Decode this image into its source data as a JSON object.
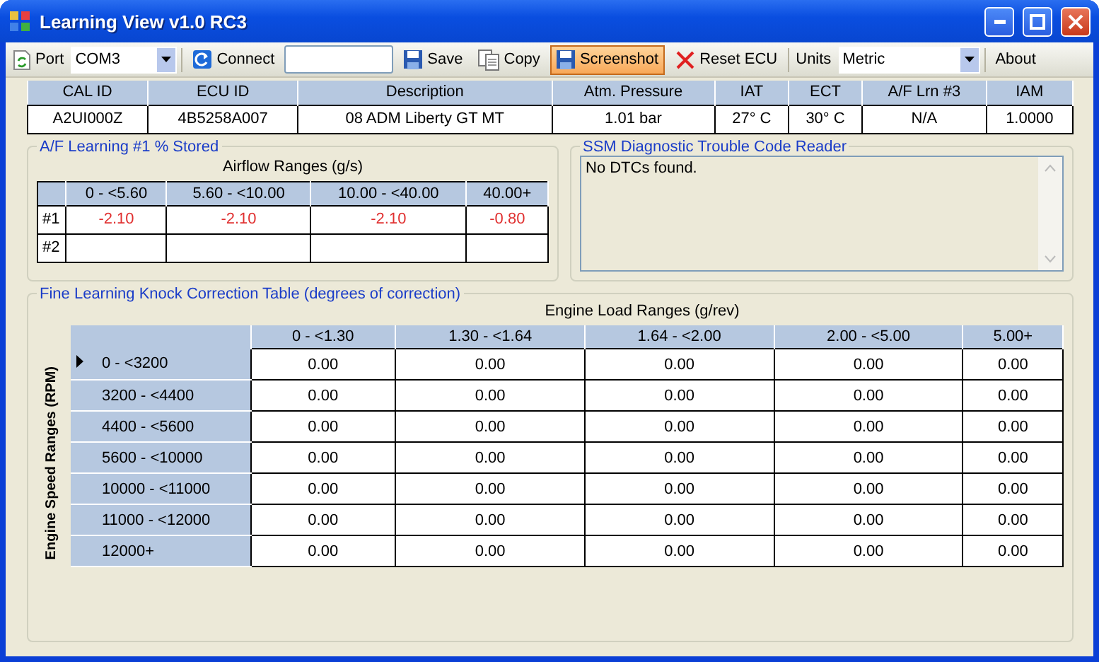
{
  "window": {
    "title": "Learning View v1.0 RC3"
  },
  "toolbar": [
    {
      "kind": "label",
      "text": "Port"
    },
    {
      "kind": "combo",
      "value": "COM3"
    },
    {
      "kind": "separator"
    },
    {
      "kind": "button",
      "text": "Connect",
      "highlighted": false
    },
    {
      "kind": "textbox"
    },
    {
      "kind": "button",
      "text": "Save",
      "highlighted": false
    },
    {
      "kind": "button",
      "text": "Copy",
      "highlighted": false
    },
    {
      "kind": "button",
      "text": "Screenshot",
      "highlighted": true
    },
    {
      "kind": "button",
      "text": "Reset ECU",
      "highlighted": false
    },
    {
      "kind": "separator"
    },
    {
      "kind": "label",
      "text": "Units"
    },
    {
      "kind": "combo",
      "value": "Metric"
    },
    {
      "kind": "separator"
    },
    {
      "kind": "button",
      "text": "About",
      "highlighted": false
    }
  ],
  "info_table": {
    "columns": [
      "CAL ID",
      "ECU ID",
      "Description",
      "Atm. Pressure",
      "IAT",
      "ECT",
      "A/F Lrn #3",
      "IAM"
    ],
    "values": [
      "A2UI000Z",
      "4B5258A007",
      "08 ADM Liberty GT MT",
      "1.01 bar",
      "27° C",
      "30° C",
      "N/A",
      "1.0000"
    ]
  },
  "af_learning": {
    "title": "A/F Learning #1 % Stored",
    "caption": "Airflow Ranges (g/s)",
    "columns": [
      "0 - <5.60",
      "5.60 - <10.00",
      "10.00 - <40.00",
      "40.00+"
    ],
    "rows": [
      {
        "label": "#1",
        "cells": [
          {
            "text": "-2.10",
            "color": "#e03030"
          },
          {
            "text": "-2.10",
            "color": "#e03030"
          },
          {
            "text": "-2.10",
            "color": "#e03030"
          },
          {
            "text": "-0.80",
            "color": "#e03030"
          }
        ]
      },
      {
        "label": "#2",
        "cells": []
      }
    ]
  },
  "dtc_reader": {
    "title": "SSM Diagnostic Trouble Code Reader",
    "text": "No DTCs found."
  },
  "knock_table": {
    "title": "Fine Learning Knock Correction Table (degrees of correction)",
    "caption": "Engine Load Ranges (g/rev)",
    "row_caption": "Engine Speed Ranges (RPM)",
    "columns": [
      "0 - <1.30",
      "1.30 - <1.64",
      "1.64 - <2.00",
      "2.00 - <5.00",
      "5.00+"
    ],
    "rows": [
      {
        "label": "0 - <3200",
        "current": true,
        "cells": [
          "0.00",
          "0.00",
          "0.00",
          "0.00",
          "0.00"
        ]
      },
      {
        "label": "3200 - <4400",
        "current": false,
        "cells": [
          "0.00",
          "0.00",
          "0.00",
          "0.00",
          "0.00"
        ]
      },
      {
        "label": "4400 - <5600",
        "current": false,
        "cells": [
          "0.00",
          "0.00",
          "0.00",
          "0.00",
          "0.00"
        ]
      },
      {
        "label": "5600 - <10000",
        "current": false,
        "cells": [
          "0.00",
          "0.00",
          "0.00",
          "0.00",
          "0.00"
        ]
      },
      {
        "label": "10000 - <11000",
        "current": false,
        "cells": [
          "0.00",
          "0.00",
          "0.00",
          "0.00",
          "0.00"
        ]
      },
      {
        "label": "11000 - <12000",
        "current": false,
        "cells": [
          "0.00",
          "0.00",
          "0.00",
          "0.00",
          "0.00"
        ]
      },
      {
        "label": "12000+",
        "current": false,
        "cells": [
          "0.00",
          "0.00",
          "0.00",
          "0.00",
          "0.00"
        ]
      }
    ]
  }
}
